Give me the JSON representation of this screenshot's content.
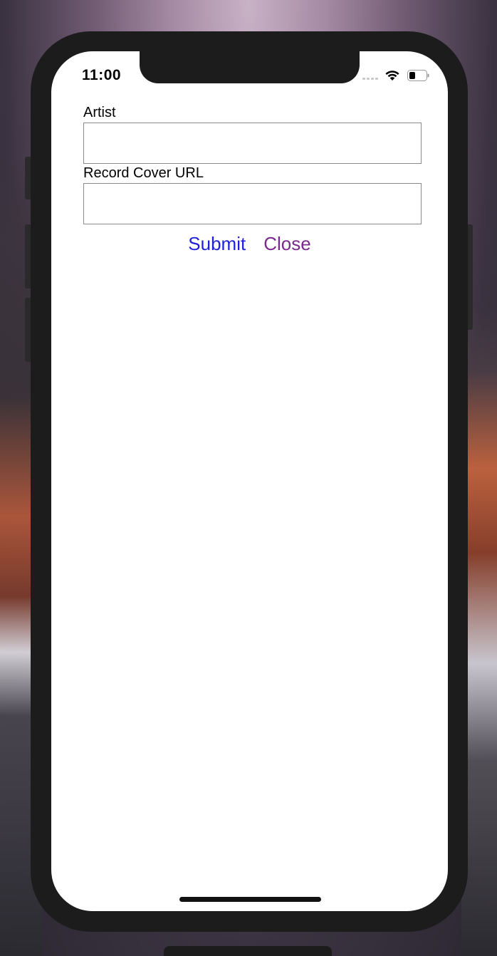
{
  "status_bar": {
    "time": "11:00",
    "wifi_icon": "wifi-icon",
    "battery_icon": "battery-icon",
    "signal_icon": "cellular-signal-icon"
  },
  "form": {
    "artist_label": "Artist",
    "artist_value": "",
    "cover_label": "Record Cover URL",
    "cover_value": ""
  },
  "actions": {
    "submit_label": "Submit",
    "close_label": "Close"
  },
  "colors": {
    "submit": "#1f1fdc",
    "close": "#7a2a8e",
    "device_frame": "#1c1c1c"
  }
}
